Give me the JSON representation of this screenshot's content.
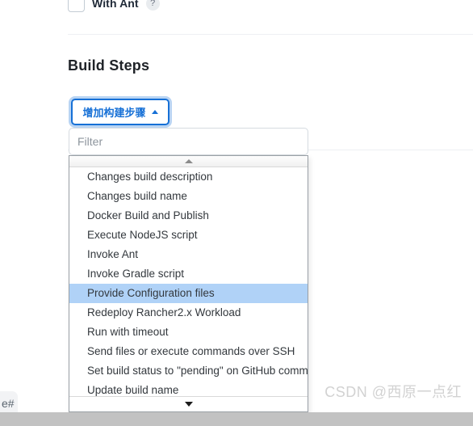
{
  "top_row": {
    "checkbox_label": "With Ant",
    "help_icon": "question-mark-icon",
    "checked": false
  },
  "section": {
    "title": "Build Steps"
  },
  "add_step_button": {
    "label": "增加构建步骤",
    "icon": "caret-up-icon",
    "border_color": "#1670d6",
    "text_color": "#1670d6"
  },
  "filter": {
    "value": "",
    "placeholder": "Filter"
  },
  "dropdown": {
    "scroll_up_icon": "caret-up-icon",
    "scroll_down_icon": "caret-down-icon",
    "selected_index": 6,
    "highlight_color": "#b0d2f7",
    "items": [
      {
        "label": "Changes build description"
      },
      {
        "label": "Changes build name"
      },
      {
        "label": "Docker Build and Publish"
      },
      {
        "label": "Execute NodeJS script"
      },
      {
        "label": "Invoke Ant"
      },
      {
        "label": "Invoke Gradle script"
      },
      {
        "label": "Provide Configuration files"
      },
      {
        "label": "Redeploy Rancher2.x Workload"
      },
      {
        "label": "Run with timeout"
      },
      {
        "label": "Send files or execute commands over SSH"
      },
      {
        "label": "Set build status to \"pending\" on GitHub commit"
      },
      {
        "label": "Update build name"
      }
    ]
  },
  "watermark": {
    "text": "CSDN @西原一点红"
  },
  "bottom_chrome": {
    "tab_label": "e#"
  }
}
